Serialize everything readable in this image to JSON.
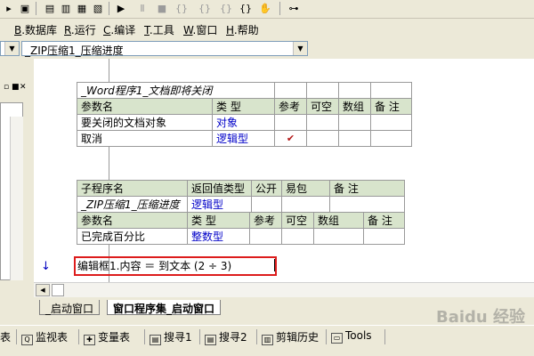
{
  "menu": [
    {
      "key": "B",
      "rest": ".数据库"
    },
    {
      "key": "R",
      "rest": ".运行"
    },
    {
      "key": "C",
      "rest": ".编译"
    },
    {
      "key": "T",
      "rest": ".工具"
    },
    {
      "key": "W",
      "rest": ".窗口"
    },
    {
      "key": "H",
      "rest": ".帮助"
    }
  ],
  "combo": {
    "subroutine": "_ZIP压缩1_压缩进度"
  },
  "table1": {
    "title": "_Word程序1_文档即将关闭",
    "headers": [
      "参数名",
      "类 型",
      "参考",
      "可空",
      "数组",
      "备 注"
    ],
    "rows": [
      {
        "name": "要关闭的文档对象",
        "type": "对象",
        "ref": ""
      },
      {
        "name": "取消",
        "type": "逻辑型",
        "ref": "✔"
      }
    ]
  },
  "table2": {
    "headers": [
      "子程序名",
      "返回值类型",
      "公开",
      "易包",
      "备 注"
    ],
    "sub": {
      "name": "_ZIP压缩1_压缩进度",
      "return_type": "逻辑型"
    },
    "param_headers": [
      "参数名",
      "类 型",
      "参考",
      "可空",
      "数组",
      "备 注"
    ],
    "params": [
      {
        "name": "已完成百分比",
        "type": "整数型"
      }
    ]
  },
  "code": {
    "line": "编辑框1.内容 ＝ 到文本 (2 ÷ 3)"
  },
  "tabs": [
    {
      "label": "_启动窗口"
    },
    {
      "label": "窗口程序集_启动窗口"
    }
  ],
  "bottombar": {
    "partial": "表",
    "items": [
      "监视表",
      "变量表",
      "搜寻1",
      "搜寻2",
      "剪辑历史",
      "Tools"
    ]
  },
  "watermark": "Baidu 经验"
}
